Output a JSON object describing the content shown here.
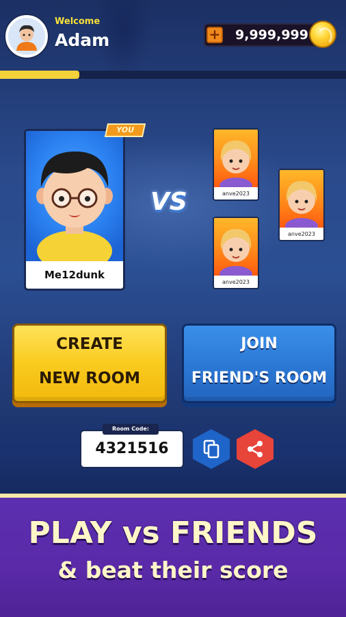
{
  "header": {
    "welcome_label": "Welcome",
    "username": "Adam",
    "coin_balance": "9,999,999",
    "add_coins_symbol": "+",
    "xp_progress_fraction": 0.23
  },
  "match": {
    "player": {
      "name": "Me12dunk",
      "tag": "YOU"
    },
    "vs_label": "VS",
    "opponents": [
      {
        "name": "anve2023"
      },
      {
        "name": "anve2023"
      },
      {
        "name": "anve2023"
      }
    ]
  },
  "actions": {
    "create": {
      "line1": "CREATE",
      "line2": "NEW ROOM"
    },
    "join": {
      "line1": "JOIN",
      "line2": "FRIEND'S ROOM"
    }
  },
  "room": {
    "label": "Room Code:",
    "code": "4321516"
  },
  "banner": {
    "title": "PLAY vs FRIENDS",
    "subtitle": "& beat their score"
  },
  "colors": {
    "accent_yellow": "#f9cb1f",
    "accent_blue": "#2c7ad6",
    "banner_purple": "#5a2aa8",
    "share_red": "#e7443a"
  }
}
